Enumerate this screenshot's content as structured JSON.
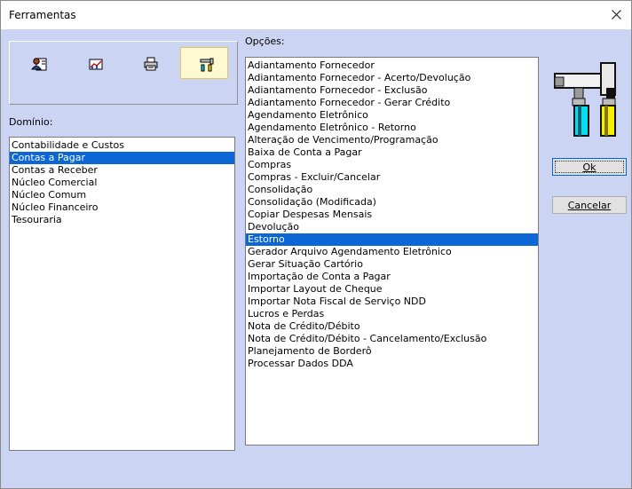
{
  "window": {
    "title": "Ferramentas"
  },
  "toolbar": {
    "tools": [
      {
        "icon": "user-card-icon",
        "active": false
      },
      {
        "icon": "chart-icon",
        "active": false
      },
      {
        "icon": "printer-icon",
        "active": false
      },
      {
        "icon": "tools-icon",
        "active": true
      }
    ]
  },
  "domain": {
    "label": "Domínio:",
    "items": [
      "Contabilidade e Custos",
      "Contas a Pagar",
      "Contas a Receber",
      "Núcleo Comercial",
      "Núcleo Comum",
      "Núcleo Financeiro",
      "Tesouraria"
    ],
    "selected": "Contas a Pagar"
  },
  "options": {
    "label": "Opções:",
    "items": [
      "Adiantamento Fornecedor",
      "Adiantamento Fornecedor - Acerto/Devolução",
      "Adiantamento Fornecedor - Exclusão",
      "Adiantamento Fornecedor - Gerar Crédito",
      "Agendamento Eletrônico",
      "Agendamento Eletrônico - Retorno",
      "Alteração de Vencimento/Programação",
      "Baixa de Conta a Pagar",
      "Compras",
      "Compras - Excluir/Cancelar",
      "Consolidação",
      "Consolidação (Modificada)",
      "Copiar Despesas Mensais",
      "Devolução",
      "Estorno",
      "Gerador Arquivo Agendamento Eletrônico",
      "Gerar Situação Cartório",
      "Importação de Conta a Pagar",
      "Importar Layout de Cheque",
      "Importar Nota Fiscal de Serviço NDD",
      "Lucros e Perdas",
      "Nota de Crédito/Débito",
      "Nota de Crédito/Débito - Cancelamento/Exclusão",
      "Planejamento de Borderô",
      "Processar Dados DDA"
    ],
    "selected": "Estorno"
  },
  "buttons": {
    "ok": "Ok",
    "cancel": "Cancelar"
  }
}
